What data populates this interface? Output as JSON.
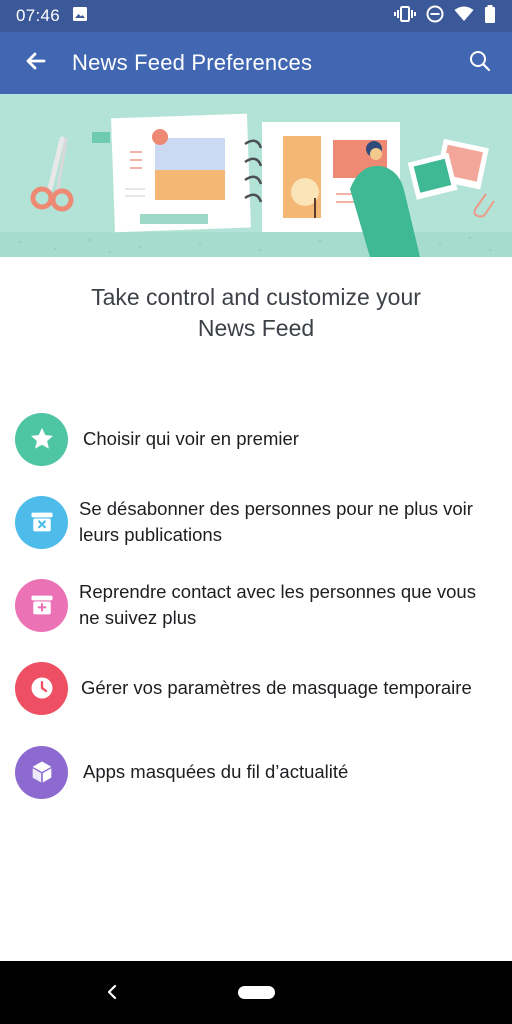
{
  "status_bar": {
    "time": "07:46",
    "icons": [
      "image-icon",
      "vibrate-icon",
      "do-not-disturb-icon",
      "wifi-icon",
      "battery-icon"
    ]
  },
  "app_bar": {
    "title": "News Feed Preferences",
    "back_icon": "arrow-left-icon",
    "search_icon": "search-icon",
    "color": "#4267b2"
  },
  "headline": {
    "line1": "Take control and customize your",
    "line2": "News Feed"
  },
  "options": [
    {
      "label": "Choisir qui voir en premier",
      "icon": "star-icon",
      "color": "#4ec6a4"
    },
    {
      "label": "Se désabonner des personnes pour ne plus voir leurs publications",
      "icon": "unfollow-box-icon",
      "color": "#4dbcea"
    },
    {
      "label": "Reprendre contact avec les personnes que vous ne suivez plus",
      "icon": "refollow-box-icon",
      "color": "#eb72b4"
    },
    {
      "label": "Gérer vos paramètres de masquage temporaire",
      "icon": "clock-icon",
      "color": "#ee4f63"
    },
    {
      "label": "Apps masquées du fil d’actualité",
      "icon": "cube-icon",
      "color": "#8c6ad0"
    }
  ],
  "nav_bar": {
    "back_icon": "nav-back-icon",
    "home_icon": "nav-home-pill"
  }
}
